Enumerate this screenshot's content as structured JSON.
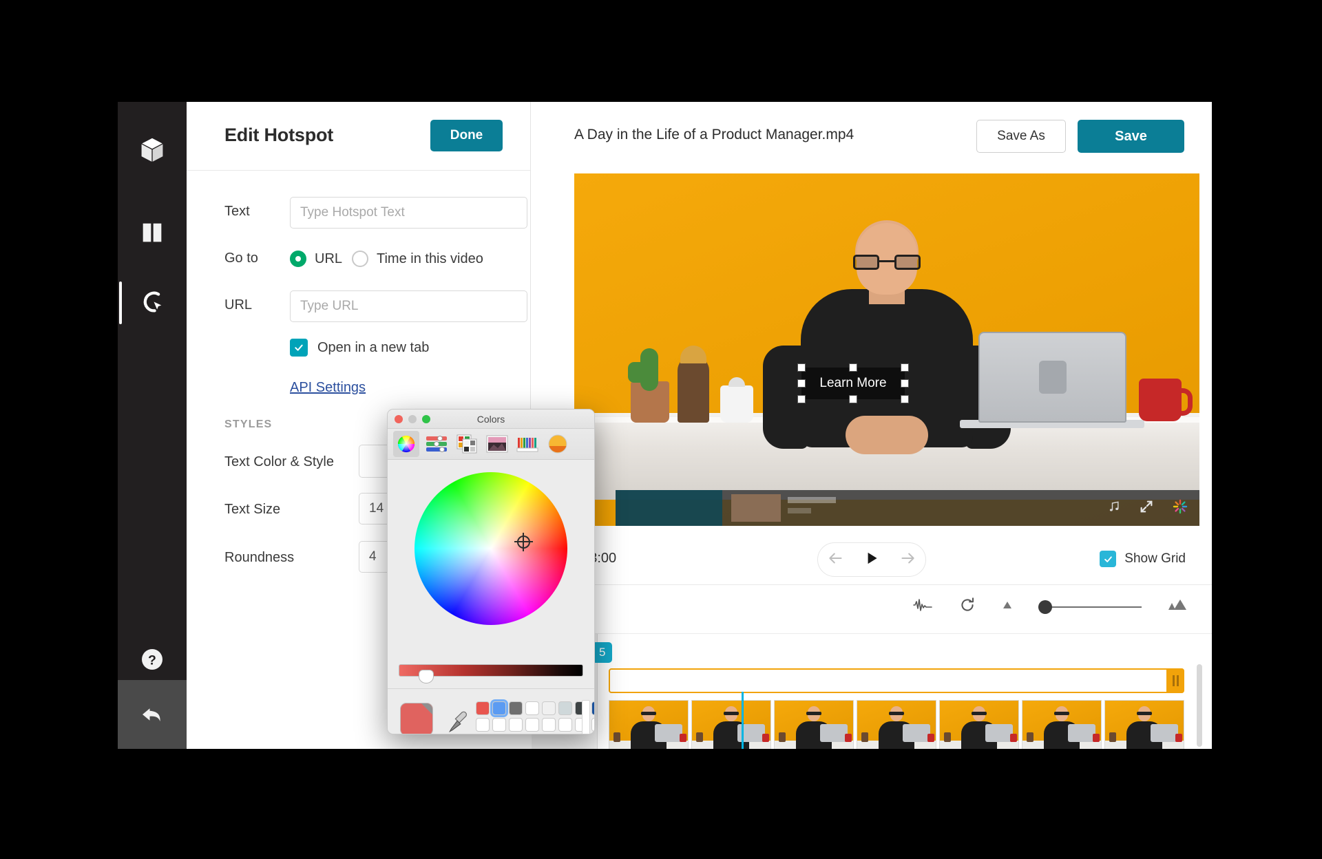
{
  "rail": {
    "items": [
      {
        "name": "library-cube",
        "icon": "cube-icon"
      },
      {
        "name": "split-clip",
        "icon": "film-split-icon"
      },
      {
        "name": "hotspot-tool",
        "icon": "hotspot-cursor-icon",
        "active": true
      }
    ],
    "help_icon": "question-circle-icon",
    "back_icon": "back-arrow-icon"
  },
  "editor": {
    "title": "Edit Hotspot",
    "done_label": "Done",
    "fields": {
      "text_label": "Text",
      "text_value": "",
      "text_placeholder": "Type Hotspot Text",
      "goto_label": "Go to",
      "goto_options": [
        {
          "label": "URL",
          "selected": true
        },
        {
          "label": "Time in this video",
          "selected": false
        }
      ],
      "url_label": "URL",
      "url_value": "",
      "url_placeholder": "Type URL",
      "new_tab_label": "Open in a new tab",
      "new_tab_checked": true,
      "api_link": "API Settings"
    },
    "styles": {
      "section_label": "STYLES",
      "text_color_label": "Text Color & Style",
      "text_color_value": "#ffffff",
      "text_size_label": "Text Size",
      "text_size_value": "14",
      "roundness_label": "Roundness",
      "roundness_value": "4"
    }
  },
  "video": {
    "filename": "A Day in the Life of a Product Manager.mp4",
    "save_as_label": "Save As",
    "save_label": "Save",
    "hotspot_text": "Learn More",
    "timecode": "/ 03:00",
    "transport": {
      "prev_icon": "arrow-left-icon",
      "play_icon": "play-icon",
      "next_icon": "arrow-right-icon"
    },
    "show_grid_label": "Show Grid",
    "show_grid_checked": true,
    "embed_icons": [
      "music-note-icon",
      "fullscreen-icon",
      "brand-burst-icon"
    ]
  },
  "timeline": {
    "tools": [
      "waveform-icon",
      "refresh-icon",
      "zoom-out-icon",
      "zoom-slider",
      "zoom-in-icon"
    ],
    "timecode_badge": "5",
    "zoom_value": 0
  },
  "colors_dialog": {
    "title": "Colors",
    "traffic_lights": [
      "close-red",
      "minimize-gray",
      "zoom-green"
    ],
    "toolbar": [
      {
        "name": "color-wheel-tab",
        "selected": true
      },
      {
        "name": "color-sliders-tab",
        "selected": false
      },
      {
        "name": "color-palettes-tab",
        "selected": false
      },
      {
        "name": "image-palettes-tab",
        "selected": false
      },
      {
        "name": "pencils-tab",
        "selected": false
      },
      {
        "name": "custom-color-tab",
        "selected": false
      }
    ],
    "current_color": "#e0635f",
    "eyedropper_icon": "eyedropper-icon",
    "swatches_row1": [
      "#e8564f",
      "#5b9bf2",
      "#6f6f6f",
      "#ffffff",
      "#f0f0f0",
      "#cfd8da",
      "#3d4344",
      "#19519c",
      "#ffffff"
    ],
    "selected_swatch_index": 1,
    "swatches_row2": [
      "#ffffff",
      "#ffffff",
      "#ffffff",
      "#ffffff",
      "#ffffff",
      "#ffffff",
      "#ffffff",
      "#ffffff",
      "#ffffff"
    ]
  },
  "colors": {
    "accent_teal": "#0b7e96",
    "radio_green": "#00a96a",
    "checkbox_teal": "#00a3b8",
    "grid_cyan": "#29b6d8",
    "badge_cyan": "#14a8c8",
    "track_orange": "#f2a30a",
    "playhead_cyan": "#00b5e2",
    "link_blue": "#2b4f9e"
  }
}
